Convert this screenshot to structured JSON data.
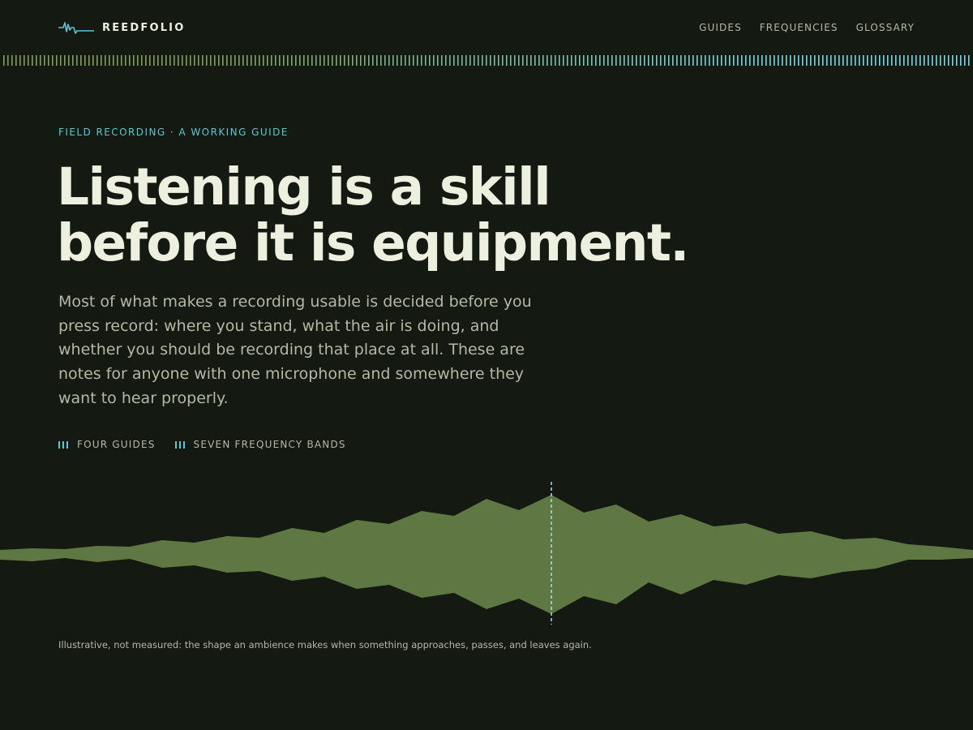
{
  "header": {
    "brand": "REEDFOLIO",
    "logo_icon": "waveform-pulse-icon",
    "nav": [
      "GUIDES",
      "FREQUENCIES",
      "GLOSSARY"
    ]
  },
  "hero": {
    "kicker": "FIELD RECORDING · A WORKING GUIDE",
    "headline": [
      "Listening is a skill",
      "before it is equipment."
    ],
    "lede": "Most of what makes a recording usable is decided before you press record: where you stand, what the air is doing, and whether you should be recording that place at all. These are notes for anyone with one microphone and somewhere they want to hear properly.",
    "stats": [
      {
        "icon": "level-bars-icon",
        "label": "FOUR GUIDES"
      },
      {
        "icon": "level-bars-icon",
        "label": "SEVEN FREQUENCY BANDS"
      }
    ]
  },
  "figure": {
    "caption": "Illustrative, not measured: the shape an ambience makes when something approaches, passes, and leaves again."
  },
  "colors": {
    "background": "#141911",
    "text": "#eef0df",
    "muted_text": "#b3b9a3",
    "accent_cyan": "#5dc6d4",
    "waveform_fill": "#5f7843",
    "tick_green": "#7fa05a"
  }
}
